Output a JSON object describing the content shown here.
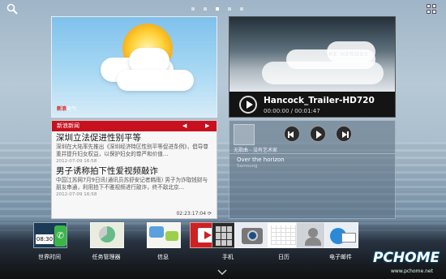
{
  "topbar": {
    "icons": [
      "search-icon",
      "apps-grid-icon"
    ],
    "page_dots": 5,
    "active_page": 3
  },
  "weather": {
    "brand_prefix": "新浪",
    "brand_suffix": "天气"
  },
  "news": {
    "header": "新浪新闻",
    "items": [
      {
        "title": "深圳立法促进性别平等",
        "body": "深圳在大陆率先推出《深圳经济特区性别平等促进条例》，倡导尊重并提升妇女权益，以保护妇女的尊严和价值…",
        "date": "2012-07-09 16:58"
      },
      {
        "title": "男子诱称拍下性爱视频敲诈",
        "body": "中国江苏网7月9日讯(通讯员苏舒安记者韩雨)  男子为诈取钱财与朋友串通，利用拍下不雅视频进行敲诈，终不敌北京…",
        "date": "2012-07-09 16:58"
      }
    ],
    "footer_time": "02:23:17:04"
  },
  "video": {
    "title": "Hancock_Trailer-HD720",
    "time": "00:00:00 / 00:01:47",
    "caption": "THERE ARE HEROES"
  },
  "music": {
    "artist": "无歌曲 - 没有艺术家",
    "song": "Over the horizon",
    "sub": "Samsung"
  },
  "dock": {
    "items": [
      {
        "label": "世界时间",
        "clock": "08:30"
      },
      {
        "label": "任务管理器"
      },
      {
        "label": "信息"
      },
      {
        "label": ""
      },
      {
        "label": "手机"
      },
      {
        "label": ""
      },
      {
        "label": "日历"
      },
      {
        "label": ""
      },
      {
        "label": "电子邮件"
      }
    ]
  },
  "watermark": {
    "text": "PCHOME",
    "sub": "www.pchome.net"
  }
}
